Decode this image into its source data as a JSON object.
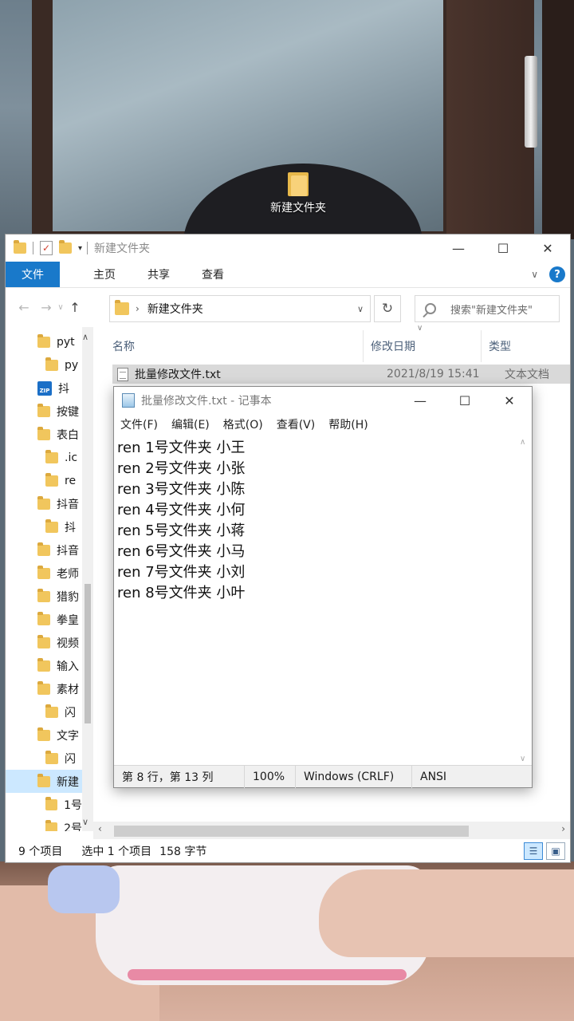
{
  "desktop": {
    "folder_label": "新建文件夹"
  },
  "explorer": {
    "title": "新建文件夹",
    "ribbon": {
      "tabs": [
        "文件",
        "主页",
        "共享",
        "查看"
      ]
    },
    "address": {
      "path": "新建文件夹",
      "search_placeholder": "搜索\"新建文件夹\""
    },
    "sidebar": [
      {
        "label": "pyt",
        "indent": 1,
        "icon": "folder-icon"
      },
      {
        "label": "py",
        "indent": 2,
        "icon": "folder-icon"
      },
      {
        "label": "抖",
        "indent": 1,
        "icon": "zip-icon"
      },
      {
        "label": "按键",
        "indent": 1,
        "icon": "folder-icon"
      },
      {
        "label": "表白",
        "indent": 1,
        "icon": "folder-icon"
      },
      {
        "label": ".ic",
        "indent": 2,
        "icon": "folder-icon"
      },
      {
        "label": "re",
        "indent": 2,
        "icon": "folder-icon"
      },
      {
        "label": "抖音",
        "indent": 1,
        "icon": "folder-icon"
      },
      {
        "label": "抖",
        "indent": 2,
        "icon": "folder-icon"
      },
      {
        "label": "抖音",
        "indent": 1,
        "icon": "folder-icon"
      },
      {
        "label": "老师",
        "indent": 1,
        "icon": "folder-icon"
      },
      {
        "label": "猎豹",
        "indent": 1,
        "icon": "folder-icon"
      },
      {
        "label": "拳皇",
        "indent": 1,
        "icon": "folder-icon"
      },
      {
        "label": "视频",
        "indent": 1,
        "icon": "folder-icon"
      },
      {
        "label": "输入",
        "indent": 1,
        "icon": "folder-icon"
      },
      {
        "label": "素材",
        "indent": 1,
        "icon": "folder-icon"
      },
      {
        "label": "闪",
        "indent": 2,
        "icon": "folder-icon"
      },
      {
        "label": "文字",
        "indent": 1,
        "icon": "folder-icon"
      },
      {
        "label": "闪",
        "indent": 2,
        "icon": "folder-icon"
      },
      {
        "label": "新建",
        "indent": 1,
        "icon": "folder-icon",
        "selected": true
      },
      {
        "label": "1号",
        "indent": 2,
        "icon": "folder-icon"
      },
      {
        "label": "2号",
        "indent": 2,
        "icon": "folder-icon"
      }
    ],
    "columns": {
      "name": "名称",
      "date": "修改日期",
      "type": "类型"
    },
    "files": [
      {
        "name": "批量修改文件.txt",
        "date": "2021/8/19 15:41",
        "type": "文本文档"
      }
    ],
    "status": {
      "count": "9 个项目",
      "selected": "选中 1 个项目",
      "size": "158 字节"
    }
  },
  "notepad": {
    "title": "批量修改文件.txt - 记事本",
    "menu": [
      "文件(F)",
      "编辑(E)",
      "格式(O)",
      "查看(V)",
      "帮助(H)"
    ],
    "lines": [
      "ren 1号文件夹 小王",
      "ren 2号文件夹 小张",
      "ren 3号文件夹 小陈",
      "ren 4号文件夹 小何",
      "ren 5号文件夹 小蒋",
      "ren 6号文件夹 小马",
      "ren 7号文件夹 小刘",
      "ren 8号文件夹 小叶"
    ],
    "status": {
      "position": "第 8 行，第 13 列",
      "zoom": "100%",
      "line_ending": "Windows (CRLF)",
      "encoding": "ANSI"
    }
  }
}
